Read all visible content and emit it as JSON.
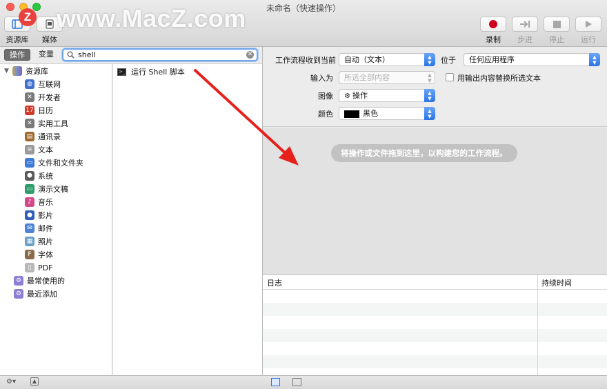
{
  "window": {
    "title": "未命名（快速操作）",
    "watermark": "www.MacZ.com",
    "watermark_logo": "Z"
  },
  "toolbar": {
    "library_label": "资源库",
    "media_label": "媒体",
    "record_label": "录制",
    "step_label": "步进",
    "stop_label": "停止",
    "run_label": "运行"
  },
  "left": {
    "tab_actions": "操作",
    "tab_variables": "变量",
    "search_value": "shell",
    "library_root": "资源库",
    "categories": [
      "互联网",
      "开发者",
      "日历",
      "实用工具",
      "通讯录",
      "文本",
      "文件和文件夹",
      "系统",
      "演示文稿",
      "音乐",
      "影片",
      "邮件",
      "照片",
      "字体",
      "PDF"
    ],
    "smart_groups": [
      "最常使用的",
      "最近添加"
    ]
  },
  "actions": {
    "result": "运行 Shell 脚本",
    "terminal_glyph": ">_"
  },
  "config": {
    "receives_label": "工作流程收到当前",
    "receives_value": "自动（文本）",
    "in_label": "位于",
    "in_value": "任何应用程序",
    "input_label": "输入为",
    "input_value": "所选全部内容",
    "replace_label": "用输出内容替换所选文本",
    "image_label": "图像",
    "image_value": "操作",
    "color_label": "颜色",
    "color_value": "黑色"
  },
  "drop_hint": "将操作或文件拖到这里，以构建您的工作流程。",
  "log": {
    "col_log": "日志",
    "col_duration": "持续时间"
  },
  "colors": {
    "accent_blue": "#2a74e6",
    "record_red": "#d0021b",
    "annotation_red": "#e8201c"
  }
}
